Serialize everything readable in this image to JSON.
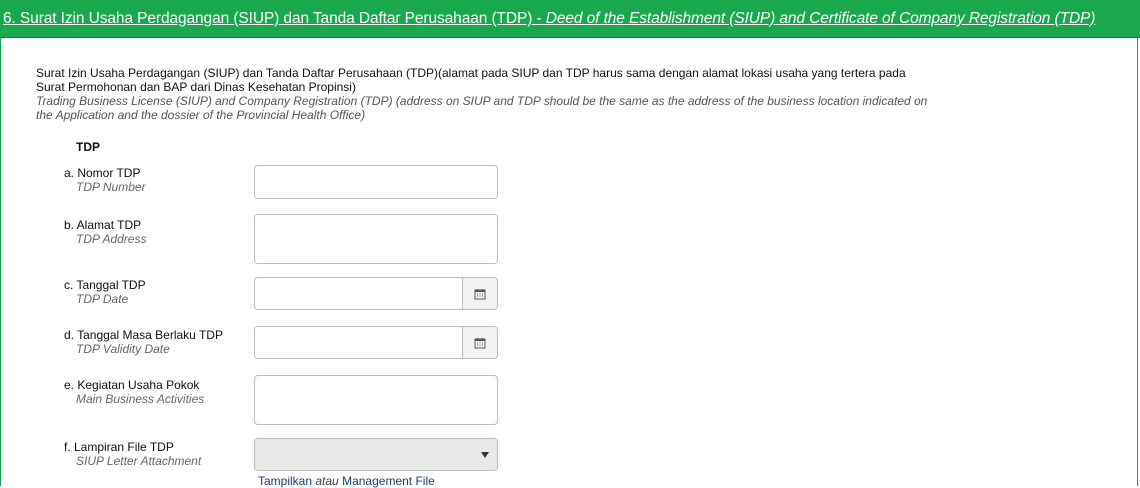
{
  "header": {
    "title_id": "6. Surat Izin Usaha Perdagangan (SIUP) dan Tanda Daftar Perusahaan (TDP)",
    "separator": " - ",
    "title_en": "Deed of the Establishment (SIUP) and Certificate of Company Registration (TDP)"
  },
  "intro": {
    "text_id": "Surat Izin Usaha Perdagangan (SIUP) dan Tanda Daftar Perusahaan (TDP)(alamat pada SIUP dan TDP harus sama dengan alamat lokasi usaha yang tertera pada Surat Permohonan dan BAP dari Dinas Kesehatan Propinsi)",
    "text_en": "Trading Business License (SIUP) and Company Registration (TDP) (address on SIUP and TDP should be the same as the address of the business location indicated on the Application and the dossier of the Provincial Health Office)"
  },
  "section": {
    "title": "TDP"
  },
  "fields": {
    "tdp_number": {
      "label_id": "a. Nomor TDP",
      "label_en": "TDP Number",
      "value": ""
    },
    "tdp_address": {
      "label_id": "b. Alamat TDP",
      "label_en": "TDP Address",
      "value": ""
    },
    "tdp_date": {
      "label_id": "c. Tanggal TDP",
      "label_en": "TDP Date",
      "value": ""
    },
    "tdp_validity": {
      "label_id": "d. Tanggal Masa Berlaku TDP",
      "label_en": "TDP Validity Date",
      "value": ""
    },
    "main_activities": {
      "label_id": "e. Kegiatan Usaha Pokok",
      "label_en": "Main Business Activities",
      "value": ""
    },
    "attachment": {
      "label_id": "f. Lampiran File TDP",
      "label_en": "SIUP Letter Attachment",
      "selected": ""
    }
  },
  "file_links": {
    "show": "Tampilkan",
    "or": "atau",
    "manage": "Management File"
  },
  "icons": {
    "calendar": "calendar-icon",
    "dropdown": "chevron-down-icon"
  },
  "colors": {
    "header_bg": "#1aa84f",
    "header_text": "#ffffff",
    "link": "#1f3d7a"
  }
}
